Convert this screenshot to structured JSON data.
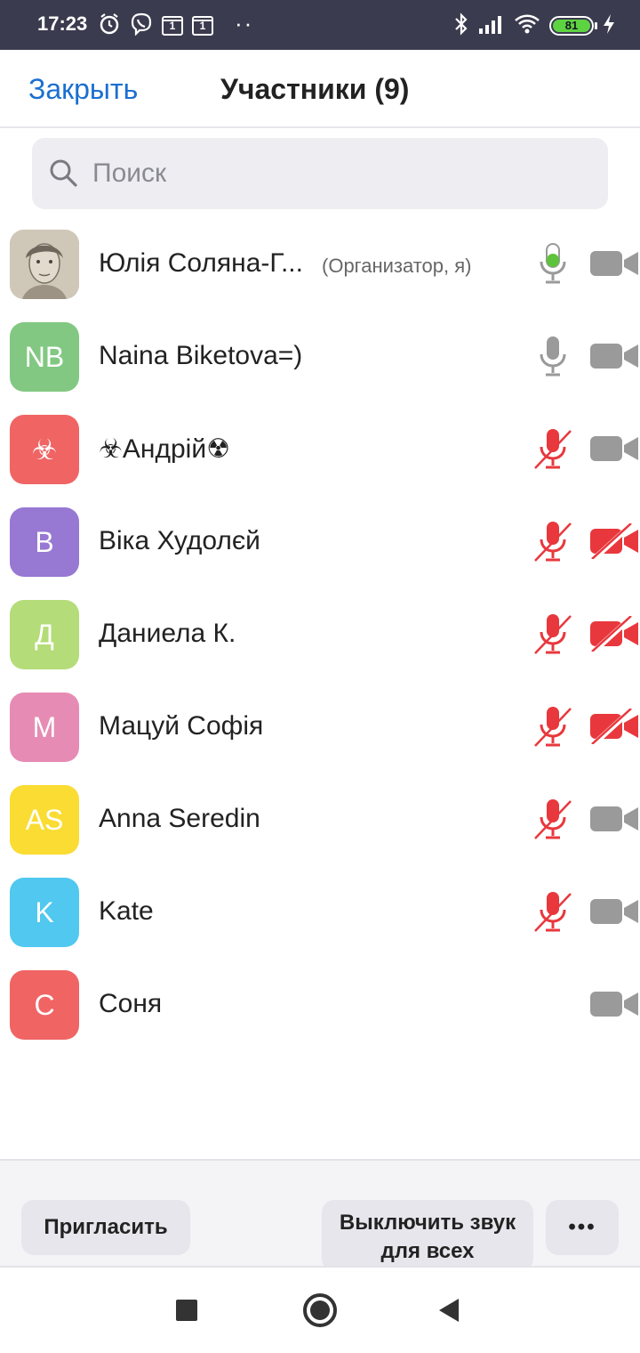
{
  "status_bar": {
    "time": "17:23",
    "calendar_day_1": "1",
    "calendar_day_2": "1",
    "more_dots": "··",
    "battery_level": "81"
  },
  "header": {
    "close_label": "Закрыть",
    "title": "Участники (9)"
  },
  "search": {
    "placeholder": "Поиск",
    "value": ""
  },
  "participants": [
    {
      "name": "Юлія Соляна-Г...",
      "role": "(Организатор, я)",
      "avatar_text": "",
      "avatar_color": "#c9c1b3",
      "mic": "active",
      "camera": "off-gray"
    },
    {
      "name": "Naina Biketova=)",
      "role": "",
      "avatar_text": "NB",
      "avatar_color": "#82c882",
      "mic": "on",
      "camera": "off-gray"
    },
    {
      "name": "☣Андрій☢",
      "role": "",
      "avatar_text": "☣",
      "avatar_color": "#f06464",
      "mic": "muted",
      "camera": "off-gray"
    },
    {
      "name": "Віка Худолєй",
      "role": "",
      "avatar_text": "В",
      "avatar_color": "#9778d2",
      "mic": "muted",
      "camera": "off-red"
    },
    {
      "name": "Даниела К.",
      "role": "",
      "avatar_text": "Д",
      "avatar_color": "#b4dc78",
      "mic": "muted",
      "camera": "off-red"
    },
    {
      "name": "Мацуй Софія",
      "role": "",
      "avatar_text": "М",
      "avatar_color": "#e68cb4",
      "mic": "muted",
      "camera": "off-red"
    },
    {
      "name": "Anna Seredin",
      "role": "",
      "avatar_text": "AS",
      "avatar_color": "#fadc32",
      "mic": "muted",
      "camera": "off-gray"
    },
    {
      "name": "Kate",
      "role": "",
      "avatar_text": "K",
      "avatar_color": "#50c8f0",
      "mic": "muted",
      "camera": "off-gray"
    },
    {
      "name": "Соня",
      "role": "",
      "avatar_text": "С",
      "avatar_color": "#f06464",
      "mic": "none",
      "camera": "off-gray"
    }
  ],
  "toolbar": {
    "invite_label": "Пригласить",
    "mute_all_label": "Выключить звук для всех",
    "more_label": "•••"
  },
  "colors": {
    "accent": "#1b6fd0",
    "mic_active": "#5ec33c",
    "muted_red": "#e8383d",
    "icon_gray": "#9a9a9a"
  }
}
